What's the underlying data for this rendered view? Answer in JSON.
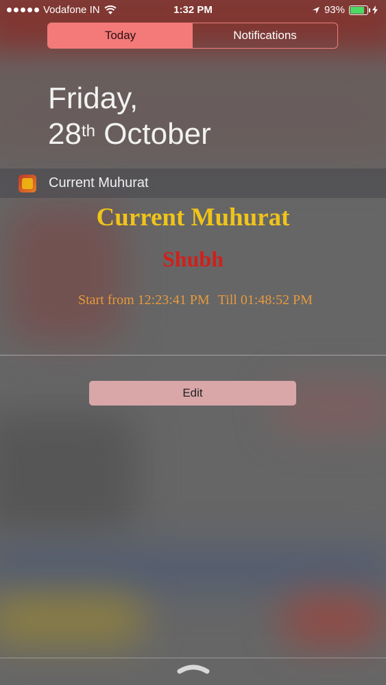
{
  "status_bar": {
    "carrier": "Vodafone IN",
    "time": "1:32 PM",
    "battery_percent": "93%",
    "battery_level": 0.93
  },
  "tabs": [
    {
      "label": "Today",
      "active": true
    },
    {
      "label": "Notifications",
      "active": false
    }
  ],
  "date": {
    "weekday": "Friday,",
    "day": "28",
    "suffix": "th",
    "month": "October"
  },
  "widget": {
    "header_title": "Current Muhurat",
    "title": "Current Muhurat",
    "muhurat_name": "Shubh",
    "start_text": "Start from 12:23:41 PM",
    "till_text": "Till 01:48:52 PM",
    "colors": {
      "title": "#f0c419",
      "name": "#d0201a",
      "times": "#e89a3c"
    }
  },
  "edit_button": {
    "label": "Edit"
  },
  "icons": [
    "signal-dots-icon",
    "wifi-icon",
    "location-arrow-icon",
    "battery-icon",
    "charging-icon",
    "app-icon",
    "pull-handle-icon"
  ]
}
